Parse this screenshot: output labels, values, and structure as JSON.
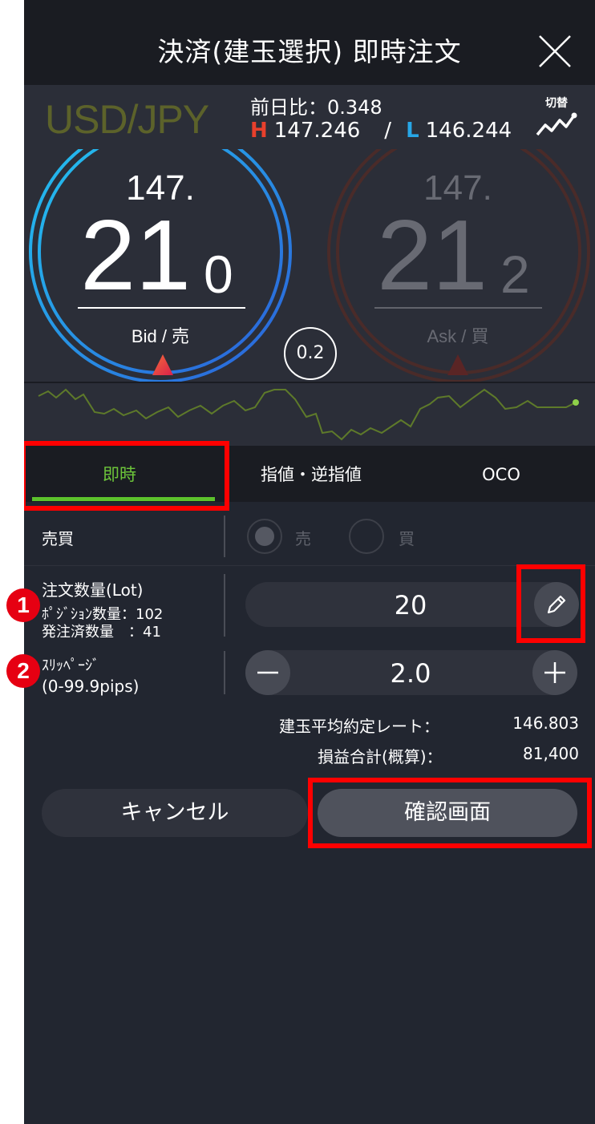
{
  "header": {
    "title": "決済(建玉選択) 即時注文"
  },
  "pair": {
    "name": "USD/JPY",
    "change": "前日比：0.348",
    "high_marker": "H",
    "high": "147.246",
    "separator": "/",
    "low_marker": "L",
    "low": "146.244",
    "switch_label": "切替"
  },
  "quote": {
    "bid_top": "147.",
    "bid_big": "21",
    "bid_small": "0",
    "bid_label": "Bid / 売",
    "ask_top": "147.",
    "ask_big": "21",
    "ask_small": "2",
    "ask_label": "Ask / 買",
    "spread": "0.2"
  },
  "tabs": [
    {
      "label": "即時"
    },
    {
      "label": "指値・逆指値"
    },
    {
      "label": "OCO"
    }
  ],
  "form": {
    "side_label": "売買",
    "sell_label": "売",
    "buy_label": "買",
    "qty_label": "注文数量(Lot)",
    "position_qty": "ﾎﾟｼﾞｼｮﾝ数量：102",
    "ordered_qty": "発注済数量　：41",
    "qty_value": "20",
    "slip_label": "ｽﾘｯﾍﾟｰｼﾞ",
    "slip_range": "(0-99.9pips)",
    "slip_value": "2.0"
  },
  "summary": {
    "avg_rate_label": "建玉平均約定レート：",
    "avg_rate": "146.803",
    "pl_label": "損益合計(概算)：",
    "pl": "81,400"
  },
  "buttons": {
    "cancel": "キャンセル",
    "confirm": "確認画面"
  },
  "badges": [
    "1",
    "2"
  ],
  "colors": {
    "accent_green": "#5cc22c",
    "high_red": "#e8402c",
    "low_blue": "#27a6e6",
    "highlight": "#ff0000",
    "badge_red": "#e60012"
  }
}
